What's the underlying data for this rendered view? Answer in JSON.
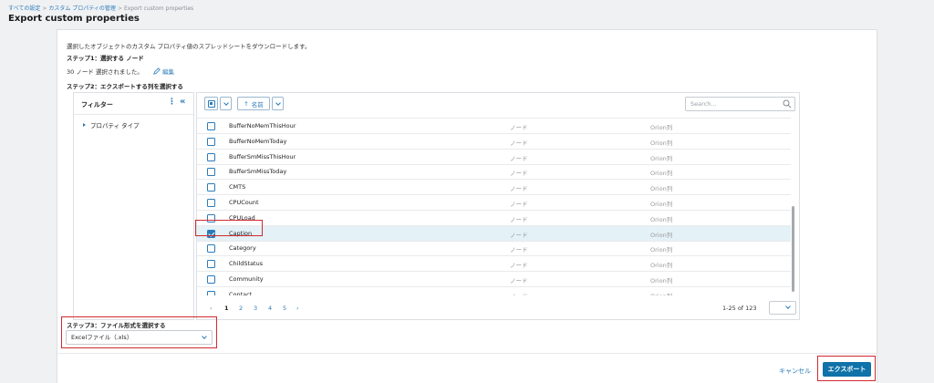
{
  "breadcrumb": {
    "items": [
      "すべての設定",
      "カスタム プロパティの管理",
      "Export custom properties"
    ]
  },
  "page": {
    "title": "Export custom properties",
    "description": "選択したオブジェクトのカスタム プロパティ値のスプレッドシートをダウンロードします。"
  },
  "step1": {
    "label": "ステップ1：選択する ノード",
    "selected_text": "30 ノード 選択されました。",
    "edit_label": "編集"
  },
  "step2": {
    "label": "ステップ2：エクスポートする列を選択する"
  },
  "filter": {
    "title": "フィルター",
    "items": [
      {
        "label": "プロパティ タイプ",
        "icon": "triangle-right-icon"
      }
    ]
  },
  "grid": {
    "sort_label": "名前",
    "search_placeholder": "Search...",
    "rows": [
      {
        "name": "BufferNoMemThisHour",
        "type": "ノード",
        "source": "Orion列",
        "checked": false
      },
      {
        "name": "BufferNoMemToday",
        "type": "ノード",
        "source": "Orion列",
        "checked": false
      },
      {
        "name": "BufferSmMissThisHour",
        "type": "ノード",
        "source": "Orion列",
        "checked": false
      },
      {
        "name": "BufferSmMissToday",
        "type": "ノード",
        "source": "Orion列",
        "checked": false
      },
      {
        "name": "CMTS",
        "type": "ノード",
        "source": "Orion列",
        "checked": false
      },
      {
        "name": "CPUCount",
        "type": "ノード",
        "source": "Orion列",
        "checked": false
      },
      {
        "name": "CPULoad",
        "type": "ノード",
        "source": "Orion列",
        "checked": false
      },
      {
        "name": "Caption",
        "type": "ノード",
        "source": "Orion列",
        "checked": true
      },
      {
        "name": "Category",
        "type": "ノード",
        "source": "Orion列",
        "checked": false
      },
      {
        "name": "ChildStatus",
        "type": "ノード",
        "source": "Orion列",
        "checked": false
      },
      {
        "name": "Community",
        "type": "ノード",
        "source": "Orion列",
        "checked": false
      },
      {
        "name": "Contact",
        "type": "ノード",
        "source": "Orion列",
        "checked": false
      }
    ],
    "pagination": {
      "prev": "‹",
      "pages": [
        "1",
        "2",
        "3",
        "4",
        "5"
      ],
      "current": "1",
      "next": "›",
      "range": "1-25 of 123"
    }
  },
  "step3": {
    "label": "ステップ3：ファイル形式を選択する",
    "selected_format": "Excelファイル（.xls）"
  },
  "footer": {
    "cancel_label": "キャンセル",
    "export_label": "エクスポート"
  },
  "colors": {
    "accent": "#2b7bb9",
    "primary_button": "#0f72a8",
    "highlight": "#d12a31",
    "selected_row": "#e4f2f7"
  }
}
